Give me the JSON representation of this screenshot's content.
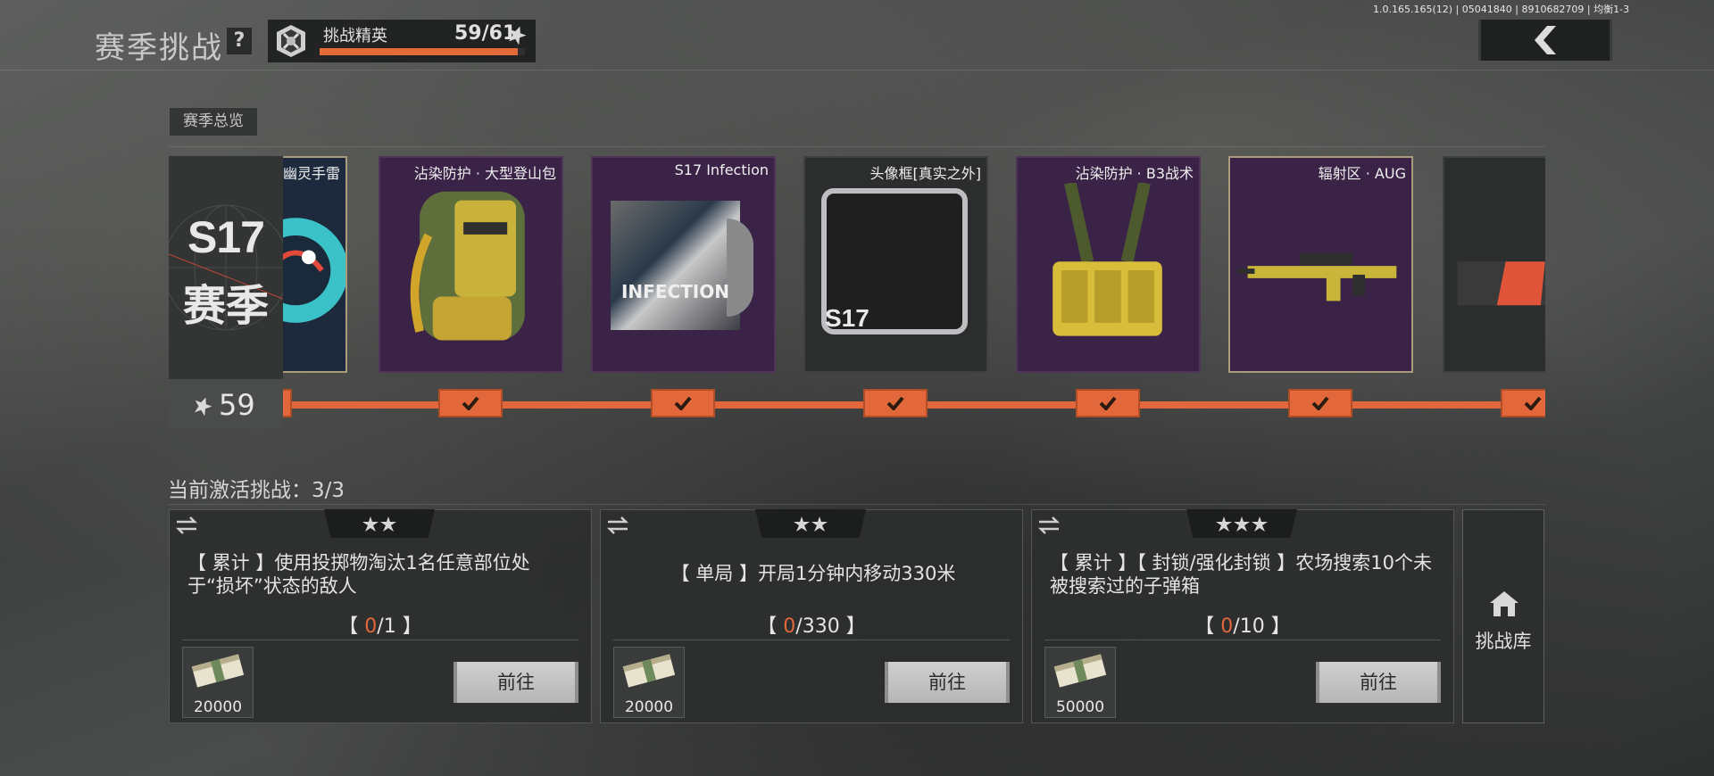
{
  "header": {
    "title": "赛季挑战",
    "help_label": "?",
    "rank": {
      "name": "挑战精英",
      "progress_text": "59/61",
      "progress_fraction": 0.967
    },
    "version_text": "1.0.165.165(12) | 05041840 | 8910682709 | 均衡1-3",
    "back_icon": "chevron-left-icon"
  },
  "overview": {
    "button_label": "赛季总览"
  },
  "season": {
    "code": "S17",
    "label": "赛季",
    "level": "59"
  },
  "rewards": [
    {
      "label": "幽灵手雷",
      "icon": "ghost-grenade"
    },
    {
      "label": "沾染防护 · 大型登山包",
      "icon": "backpack"
    },
    {
      "label": "S17 Infection",
      "icon": "infection-card",
      "art_text": "INFECTION"
    },
    {
      "label": "头像框[真实之外]",
      "icon": "avatar-frame",
      "art_text": "S17"
    },
    {
      "label": "沾染防护 · B3战术",
      "icon": "tactical-vest"
    },
    {
      "label": "辐射区 · AUG",
      "icon": "rifle"
    },
    {
      "label": "",
      "icon": "weapon-skin"
    }
  ],
  "challenges_section": {
    "title": "当前激活挑战：3/3"
  },
  "challenges": [
    {
      "stars": 2,
      "description": "【 累计 】使用投掷物淘汰1名任意部位处于“损坏”状态的敌人",
      "progress_open": "【 ",
      "progress_current": "0",
      "progress_rest": "/1 】",
      "reward_amount": "20000",
      "button_label": "前往"
    },
    {
      "stars": 2,
      "description": "【 单局 】开局1分钟内移动330米",
      "progress_open": "【 ",
      "progress_current": "0",
      "progress_rest": "/330 】",
      "reward_amount": "20000",
      "button_label": "前往"
    },
    {
      "stars": 3,
      "description": "【 累计 】【 封锁/强化封锁 】农场搜索10个未被搜索过的子弹箱",
      "progress_open": "【 ",
      "progress_current": "0",
      "progress_rest": "/10 】",
      "reward_amount": "50000",
      "button_label": "前往"
    }
  ],
  "library": {
    "label": "挑战库",
    "icon": "home-icon"
  },
  "colors": {
    "accent": "#e2673a",
    "purple_card": "#3a2346",
    "gray_card": "#2c2d2d"
  }
}
